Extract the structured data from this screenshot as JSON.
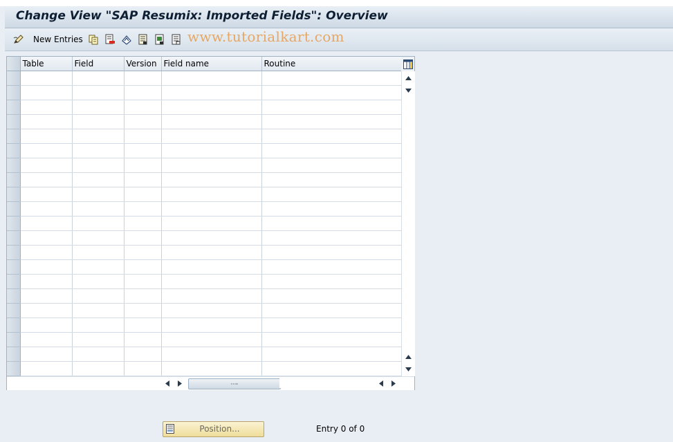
{
  "title": "Change View \"SAP Resumix: Imported Fields\": Overview",
  "toolbar": {
    "new_entries_label": "New Entries",
    "icons": [
      "edit-pen-icon",
      "copy-icon",
      "delete-icon",
      "undo-icon",
      "select-all-icon",
      "select-block-icon",
      "deselect-all-icon"
    ]
  },
  "watermark": "www.tutorialkart.com",
  "table": {
    "columns": [
      "Table",
      "Field",
      "Version",
      "Field name",
      "Routine"
    ],
    "row_count": 21
  },
  "footer": {
    "position_label": "Position...",
    "entry_text": "Entry 0 of 0"
  },
  "colors": {
    "background": "#e8eef4",
    "title_text": "#0f1f33",
    "watermark": "#e6a766",
    "position_button": "#efdd9a"
  }
}
